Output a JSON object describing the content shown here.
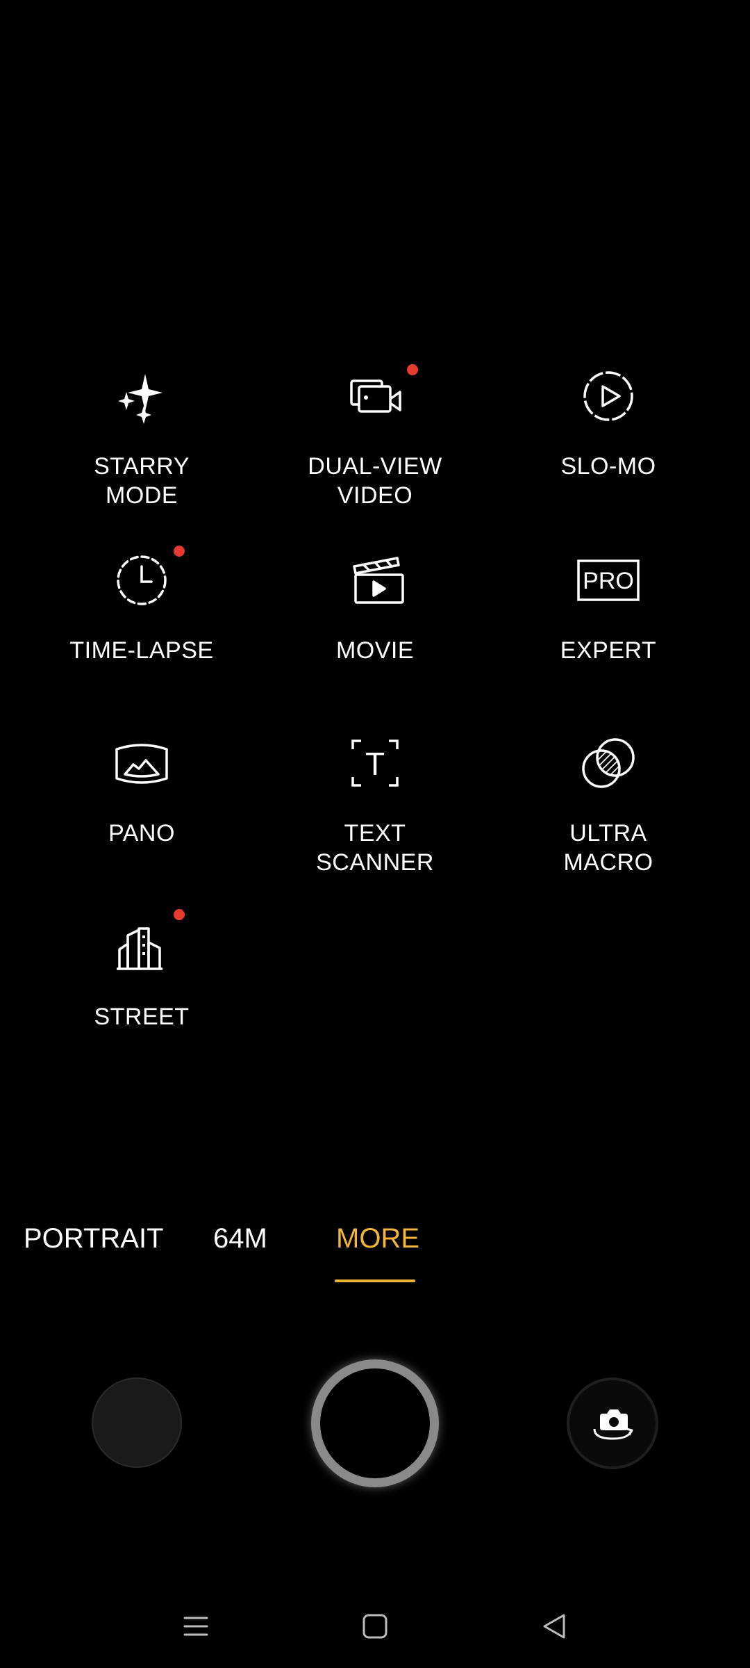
{
  "modes": [
    {
      "id": "starry",
      "label": "STARRY\nMODE",
      "icon": "sparkles-icon",
      "new": false
    },
    {
      "id": "dual-view",
      "label": "DUAL-VIEW\nVIDEO",
      "icon": "dual-view-video-icon",
      "new": true
    },
    {
      "id": "slo-mo",
      "label": "SLO-MO",
      "icon": "slo-mo-icon",
      "new": false
    },
    {
      "id": "time-lapse",
      "label": "TIME-LAPSE",
      "icon": "time-lapse-icon",
      "new": true
    },
    {
      "id": "movie",
      "label": "MOVIE",
      "icon": "clapperboard-icon",
      "new": false
    },
    {
      "id": "expert",
      "label": "EXPERT",
      "icon": "pro-icon",
      "new": false,
      "icon_text": "PRO"
    },
    {
      "id": "pano",
      "label": "PANO",
      "icon": "panorama-icon",
      "new": false
    },
    {
      "id": "text-scanner",
      "label": "TEXT\nSCANNER",
      "icon": "text-scanner-icon",
      "new": false,
      "icon_text": "T"
    },
    {
      "id": "ultra-macro",
      "label": "ULTRA\nMACRO",
      "icon": "ultra-macro-icon",
      "new": false
    },
    {
      "id": "street",
      "label": "STREET",
      "icon": "street-buildings-icon",
      "new": true
    }
  ],
  "mode_strip": {
    "items": [
      {
        "label": "PORTRAIT",
        "active": false
      },
      {
        "label": "64M",
        "active": false
      },
      {
        "label": "MORE",
        "active": true
      }
    ]
  },
  "controls": {
    "gallery": "gallery-thumbnail",
    "shutter": "shutter-button",
    "flip": "switch-camera-icon"
  },
  "navbar": {
    "items": [
      "menu-icon",
      "home-icon",
      "back-icon"
    ]
  },
  "colors": {
    "background": "#000000",
    "accent": "#f2b538",
    "new_dot": "#e53a2f",
    "text": "#ffffff"
  }
}
